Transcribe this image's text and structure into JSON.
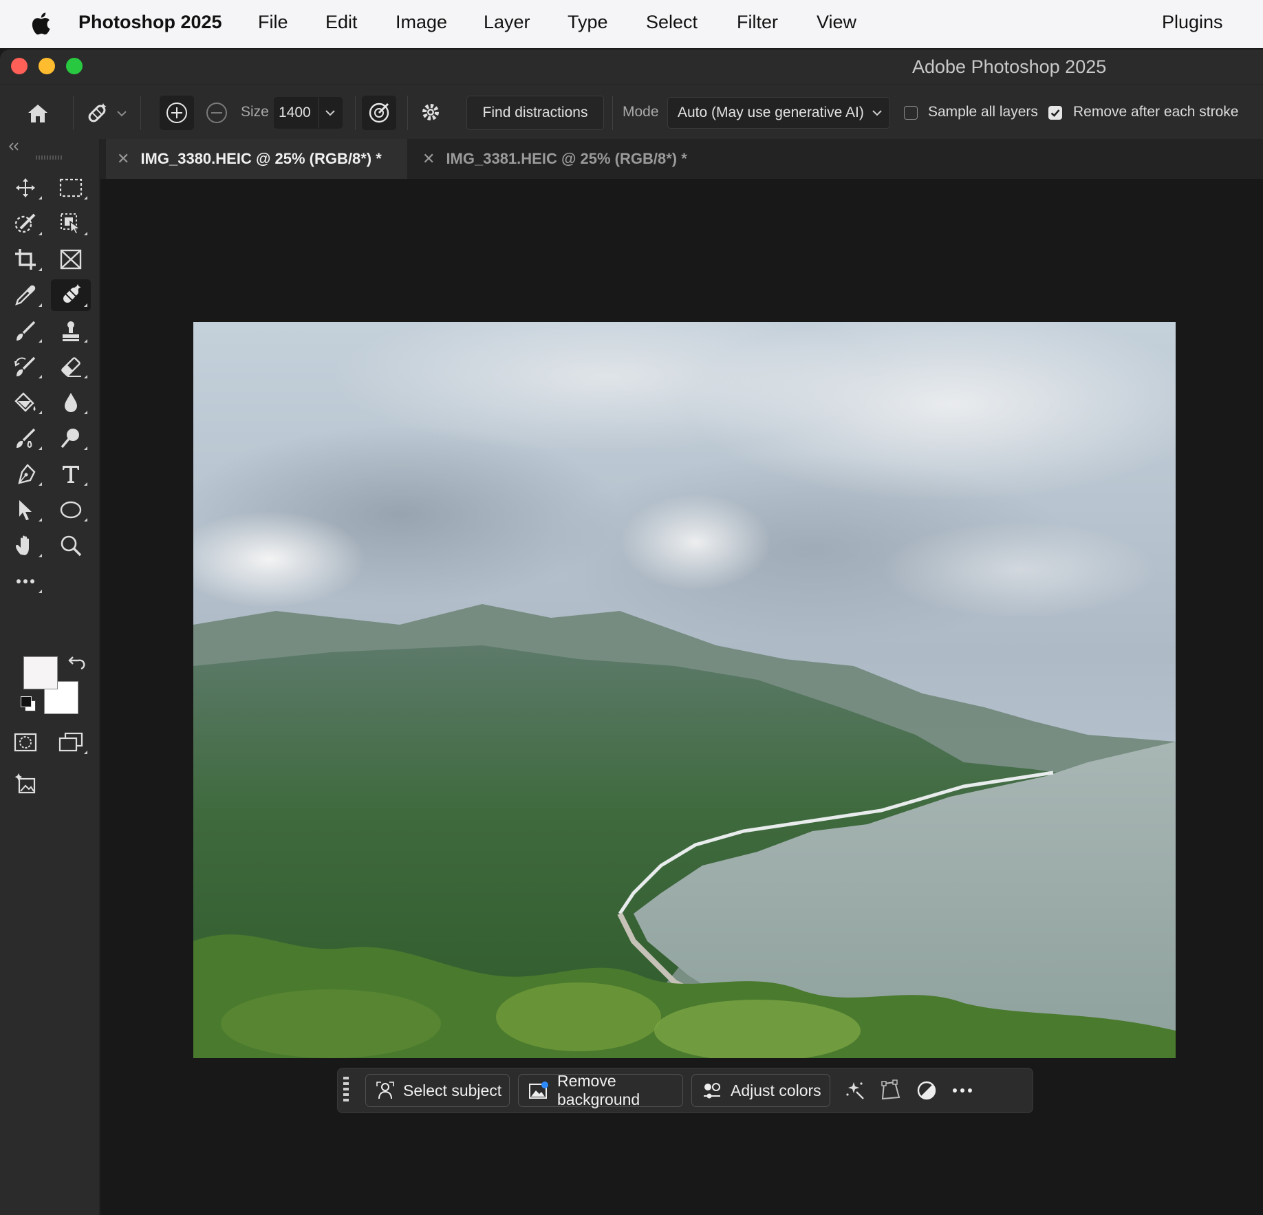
{
  "menubar": {
    "app_name": "Photoshop 2025",
    "items": [
      "File",
      "Edit",
      "Image",
      "Layer",
      "Type",
      "Select",
      "Filter",
      "View",
      "Plugins"
    ]
  },
  "window": {
    "title": "Adobe Photoshop 2025"
  },
  "options": {
    "size_label": "Size",
    "size_value": "1400",
    "find_distractions_label": "Find distractions",
    "mode_label": "Mode",
    "mode_value": "Auto (May use generative AI)",
    "sample_all_layers_label": "Sample all layers",
    "sample_all_layers_checked": false,
    "remove_after_stroke_label": "Remove after each stroke",
    "remove_after_stroke_checked": true
  },
  "tabs": [
    {
      "label": "IMG_3380.HEIC @ 25% (RGB/8*) *",
      "active": true
    },
    {
      "label": "IMG_3381.HEIC @ 25% (RGB/8*) *",
      "active": false
    }
  ],
  "taskbar": {
    "select_subject_label": "Select subject",
    "remove_background_label": "Remove background",
    "adjust_colors_label": "Adjust colors"
  },
  "colors": {
    "foreground": "#f7f4f5",
    "background": "#ffffff",
    "ui_dark": "#2b2b2b"
  }
}
